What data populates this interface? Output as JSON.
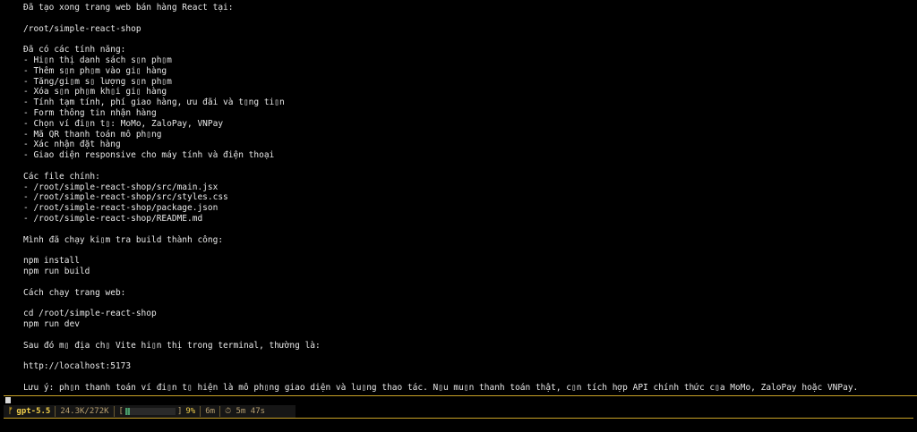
{
  "terminal": {
    "lines": [
      "Đã tạo xong trang web bán hàng React tại:",
      "",
      "/root/simple-react-shop",
      "",
      "Đã có các tính năng:",
      "- Hi▯n thị danh sách s▯n ph▯m",
      "- Thêm s▯n ph▯m vào gi▯ hàng",
      "- Tăng/gi▯m s▯ lượng s▯n ph▯m",
      "- Xóa s▯n ph▯m kh▯i gi▯ hàng",
      "- Tính tạm tính, phí giao hàng, ưu đãi và t▯ng ti▯n",
      "- Form thông tin nhận hàng",
      "- Chọn ví đi▯n t▯: MoMo, ZaloPay, VNPay",
      "- Mã QR thanh toán mô ph▯ng",
      "- Xác nhận đặt hàng",
      "- Giao diện responsive cho máy tính và điện thoại",
      "",
      "Các file chính:",
      "- /root/simple-react-shop/src/main.jsx",
      "- /root/simple-react-shop/src/styles.css",
      "- /root/simple-react-shop/package.json",
      "- /root/simple-react-shop/README.md",
      "",
      "Mình đã chạy ki▯m tra build thành công:",
      "",
      "npm install",
      "npm run build",
      "",
      "Cách chạy trang web:",
      "",
      "cd /root/simple-react-shop",
      "npm run dev",
      "",
      "Sau đó m▯ địa ch▯ Vite hi▯n thị trong terminal, thường là:",
      "",
      "http://localhost:5173",
      "",
      "Lưu ý: ph▯n thanh toán ví đi▯n t▯ hiện là mô ph▯ng giao diện và lu▯ng thao tác. N▯u mu▯n thanh toán thật, c▯n tích hợp API chính thức c▯a MoMo, ZaloPay hoặc VNPay."
    ]
  },
  "statusbar": {
    "branch_icon": "ᚠ",
    "model": "gpt-5.5",
    "tokens": "24.3K/272K",
    "progress_open": "[",
    "progress_close": "]",
    "progress_fraction": 0.09,
    "percent": "9%",
    "elapsed": "6m",
    "timer_icon": "⏱",
    "session": "5m 47s"
  },
  "colors": {
    "background": "#000000",
    "text": "#e8e8e8",
    "accent": "#c9a227",
    "model": "#f2cf4a",
    "progress": "#4a9a6a"
  },
  "icons": [
    "branch-icon",
    "timer-icon",
    "cursor-block"
  ]
}
